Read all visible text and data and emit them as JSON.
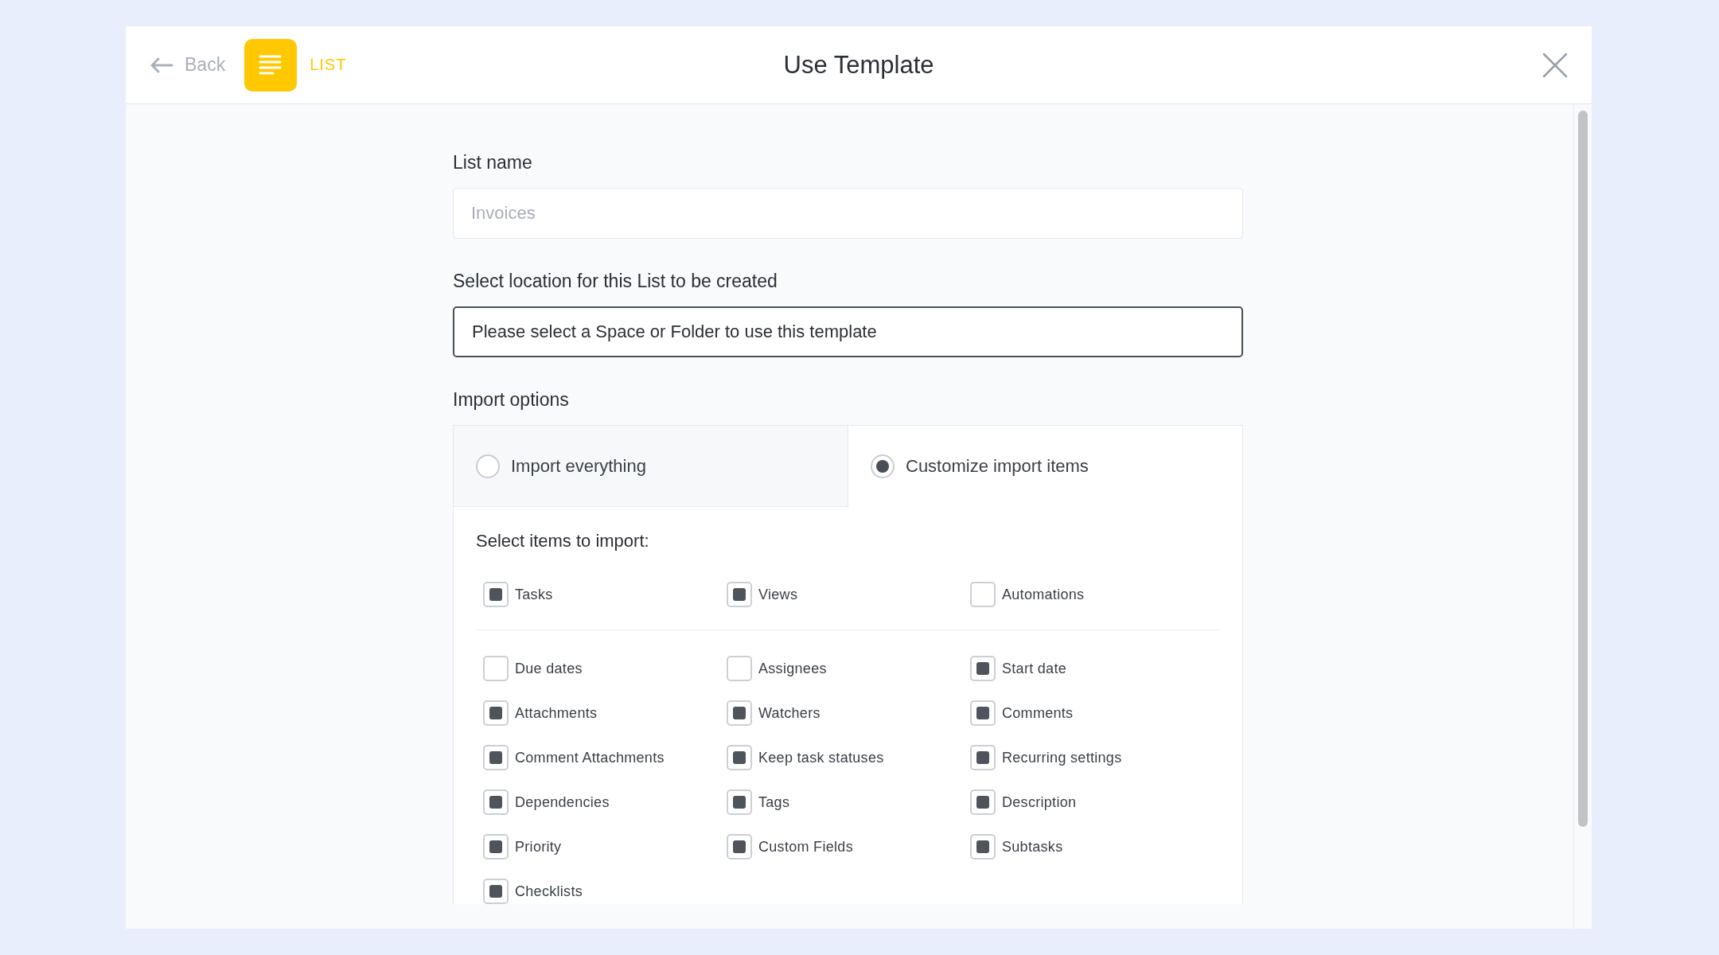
{
  "header": {
    "back": "Back",
    "badge": "LIST",
    "title": "Use Template"
  },
  "form": {
    "name_label": "List name",
    "name_field": {
      "placeholder": "Invoices"
    },
    "location_label": "Select location for this List to be created",
    "location_select": {
      "value": "Please select a Space or Folder to use this template"
    },
    "import_label": "Import options",
    "import_options": [
      {
        "label": "Import everything",
        "selected": false
      },
      {
        "label": "Customize import items",
        "selected": true
      }
    ],
    "items_heading": "Select items to import:",
    "primary_items": [
      {
        "label": "Tasks",
        "checked": true
      },
      {
        "label": "Views",
        "checked": true
      },
      {
        "label": "Automations",
        "checked": false
      }
    ],
    "detail_items": [
      {
        "label": "Due dates",
        "checked": false
      },
      {
        "label": "Assignees",
        "checked": false
      },
      {
        "label": "Start date",
        "checked": true
      },
      {
        "label": "Attachments",
        "checked": true
      },
      {
        "label": "Watchers",
        "checked": true
      },
      {
        "label": "Comments",
        "checked": true
      },
      {
        "label": "Comment Attachments",
        "checked": true
      },
      {
        "label": "Keep task statuses",
        "checked": true
      },
      {
        "label": "Recurring settings",
        "checked": true
      },
      {
        "label": "Dependencies",
        "checked": true
      },
      {
        "label": "Tags",
        "checked": true
      },
      {
        "label": "Description",
        "checked": true
      },
      {
        "label": "Priority",
        "checked": true
      },
      {
        "label": "Custom Fields",
        "checked": true
      },
      {
        "label": "Subtasks",
        "checked": true
      },
      {
        "label": "Checklists",
        "checked": true
      }
    ]
  }
}
